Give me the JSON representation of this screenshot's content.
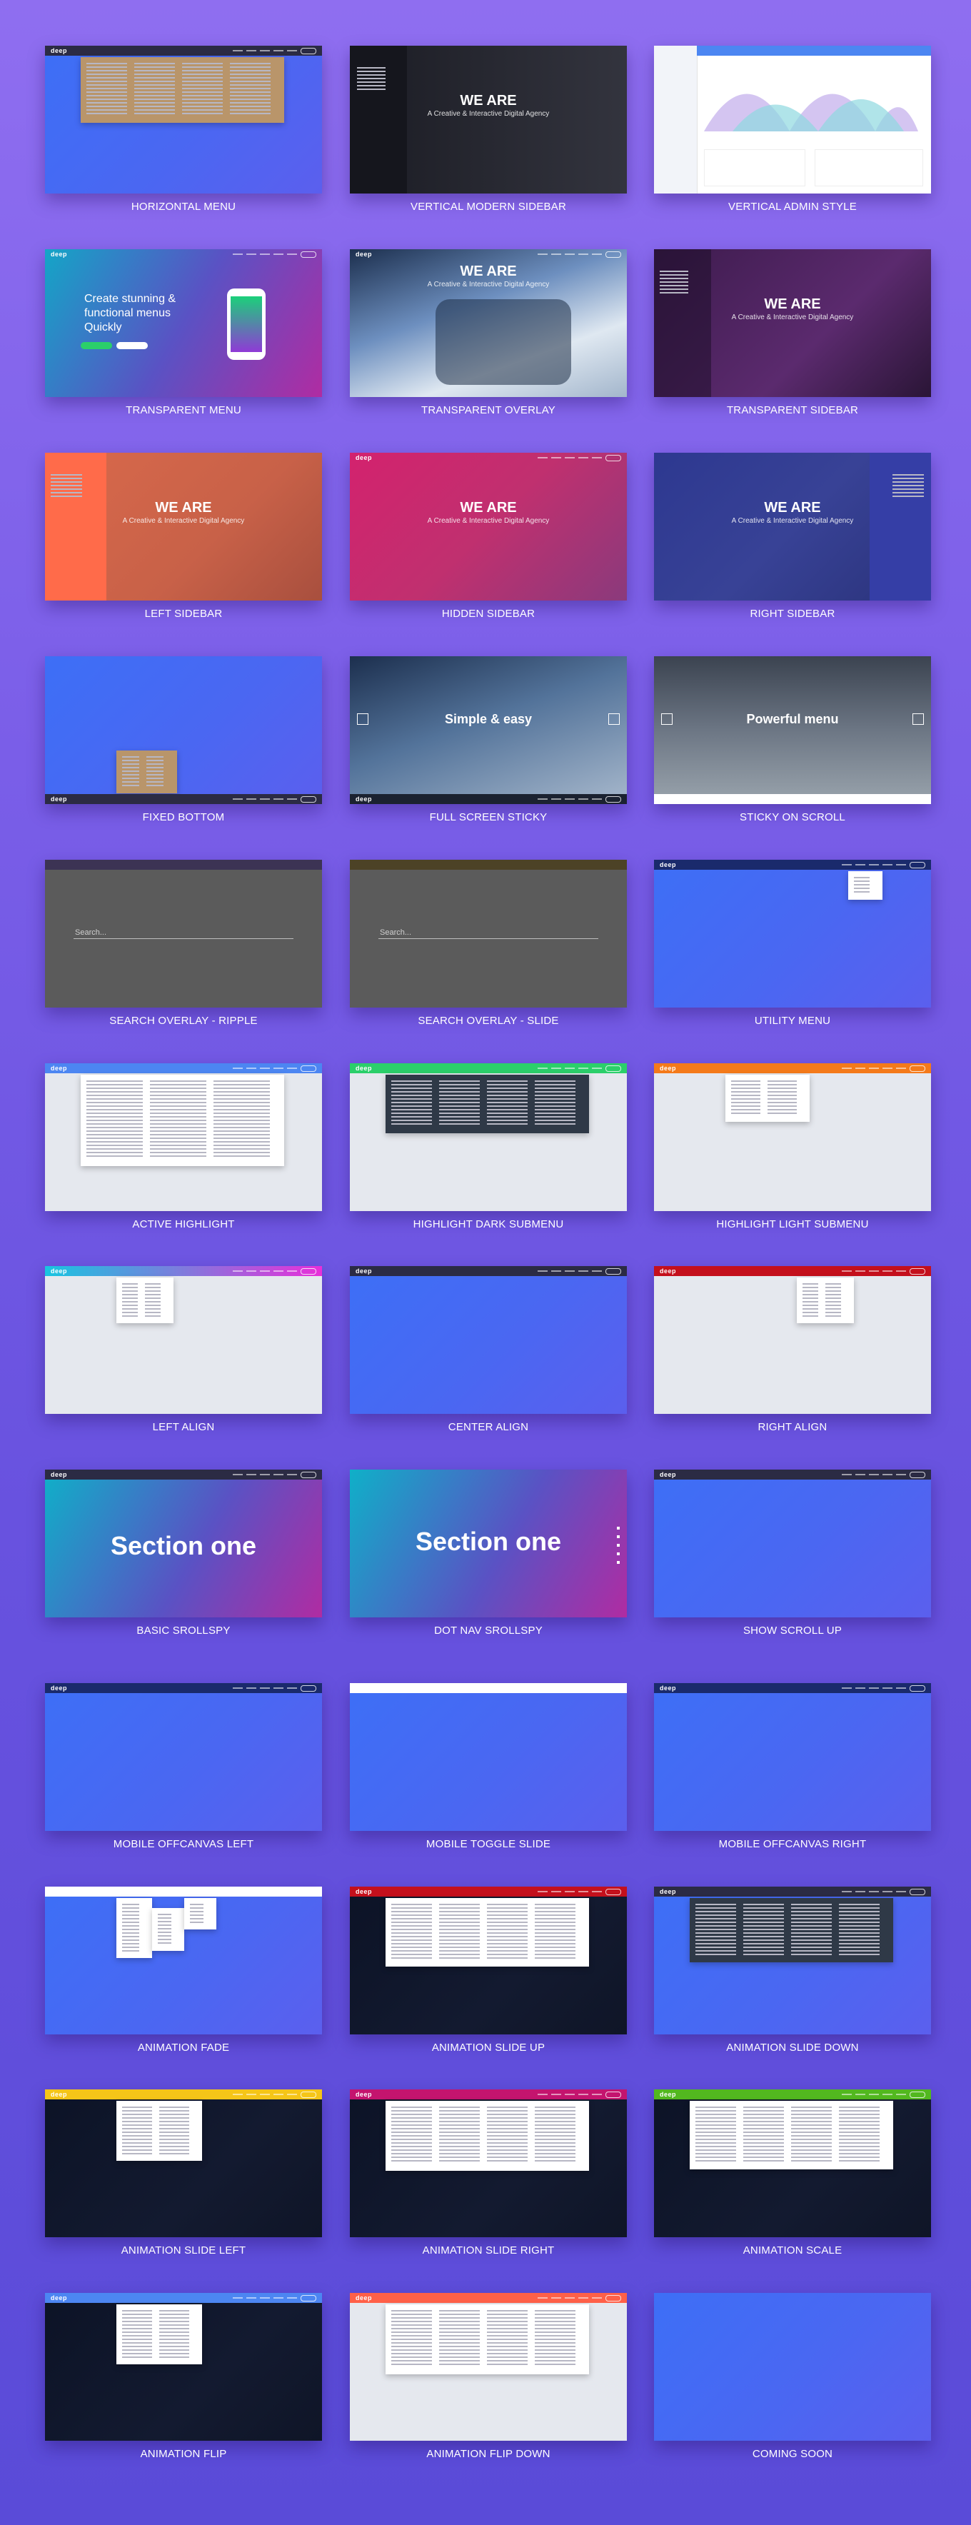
{
  "cards": [
    {
      "caption": "HORIZONTAL MENU"
    },
    {
      "caption": "VERTICAL MODERN SIDEBAR"
    },
    {
      "caption": "VERTICAL ADMIN STYLE"
    },
    {
      "caption": "TRANSPARENT MENU"
    },
    {
      "caption": "TRANSPARENT OVERLAY"
    },
    {
      "caption": "TRANSPARENT SIDEBAR"
    },
    {
      "caption": "LEFT SIDEBAR"
    },
    {
      "caption": "HIDDEN SIDEBAR"
    },
    {
      "caption": "RIGHT SIDEBAR"
    },
    {
      "caption": "FIXED BOTTOM"
    },
    {
      "caption": "FULL SCREEN STICKY"
    },
    {
      "caption": "STICKY ON SCROLL"
    },
    {
      "caption": "SEARCH OVERLAY - RIPPLE"
    },
    {
      "caption": "SEARCH OVERLAY - SLIDE"
    },
    {
      "caption": "UTILITY MENU"
    },
    {
      "caption": "ACTIVE HIGHLIGHT"
    },
    {
      "caption": "HIGHLIGHT DARK SUBMENU"
    },
    {
      "caption": "HIGHLIGHT LIGHT SUBMENU"
    },
    {
      "caption": "LEFT ALIGN"
    },
    {
      "caption": "CENTER ALIGN"
    },
    {
      "caption": "RIGHT ALIGN"
    },
    {
      "caption": "BASIC SROLLSPY"
    },
    {
      "caption": "DOT NAV SROLLSPY"
    },
    {
      "caption": "SHOW SCROLL UP"
    },
    {
      "caption": "MOBILE OFFCANVAS LEFT"
    },
    {
      "caption": "MOBILE TOGGLE SLIDE"
    },
    {
      "caption": "MOBILE OFFCANVAS RIGHT"
    },
    {
      "caption": "ANIMATION FADE"
    },
    {
      "caption": "ANIMATION SLIDE UP"
    },
    {
      "caption": "ANIMATION SLIDE DOWN"
    },
    {
      "caption": "ANIMATION SLIDE LEFT"
    },
    {
      "caption": "ANIMATION SLIDE RIGHT"
    },
    {
      "caption": "ANIMATION SCALE"
    },
    {
      "caption": "ANIMATION FLIP"
    },
    {
      "caption": "ANIMATION FLIP DOWN"
    },
    {
      "caption": "COMING SOON"
    }
  ],
  "thumb_text": {
    "we_are": "WE ARE",
    "creative_agency": "A Creative & Interactive Digital Agency",
    "create_stunning": "Create stunning & functional menus Quickly",
    "simple_easy": "Simple & easy",
    "powerful_menu": "Powerful menu",
    "search_placeholder": "Search...",
    "section_one": "Section one",
    "logo": "deep"
  },
  "colors": {
    "blue_grad_start": "#3c6ff5",
    "blue_grad_end": "#5960f0",
    "dark_nav": "#2b2b44",
    "accent_green": "#2bcf6a",
    "accent_orange": "#f47a1a",
    "accent_red": "#d01b1b"
  }
}
